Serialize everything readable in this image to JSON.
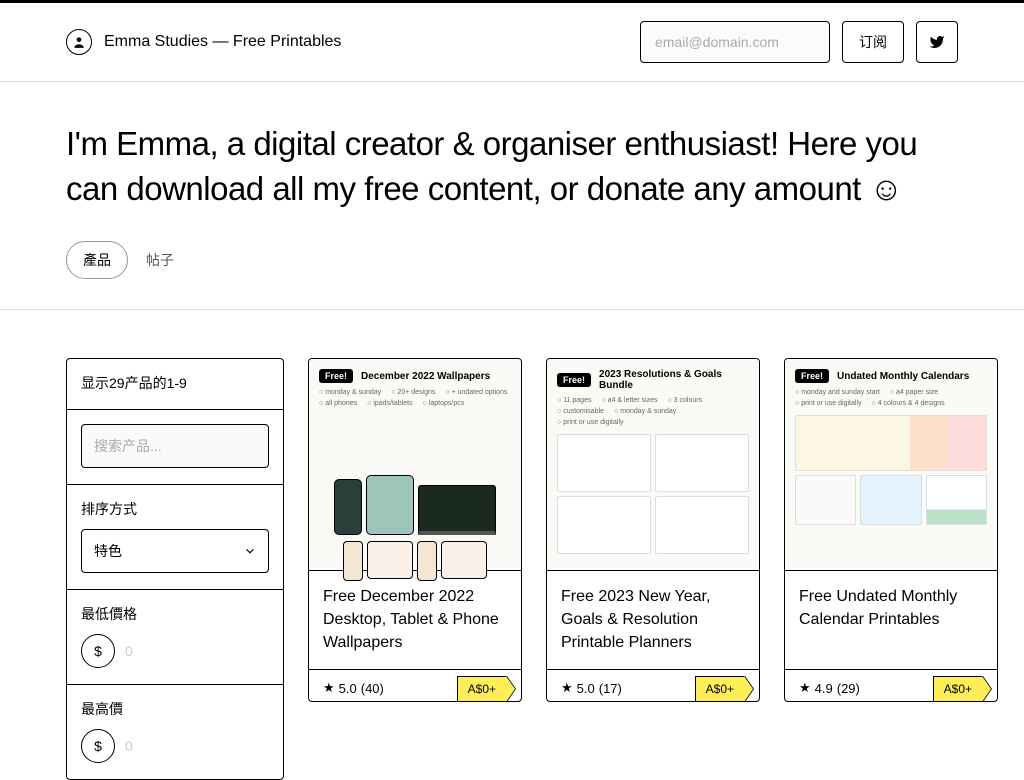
{
  "header": {
    "title": "Emma Studies — Free Printables",
    "email_placeholder": "email@domain.com",
    "subscribe_label": "订阅"
  },
  "hero": {
    "text": "I'm Emma, a digital creator & organiser enthusiast! Here you can download all my free content, or donate any amount ☺"
  },
  "tabs": {
    "products": "產品",
    "posts": "帖子"
  },
  "sidebar": {
    "results_count": "显示29产品的1-9",
    "search_placeholder": "搜索产品...",
    "sort_label": "排序方式",
    "sort_value": "特色",
    "min_price_label": "最低價格",
    "max_price_label": "最高價",
    "currency": "$",
    "price_placeholder": "0"
  },
  "thumbs": [
    {
      "free": "Free!",
      "title": "December 2022 Wallpapers",
      "meta": [
        "monday & sunday",
        "20+ designs",
        "+ undated options",
        "all phones",
        "ipads/tablets",
        "laptops/pcs"
      ]
    },
    {
      "free": "Free!",
      "title": "2023 Resolutions & Goals Bundle",
      "meta": [
        "11 pages",
        "a4 & letter sizes",
        "3 colours",
        "customisable",
        "monday & sunday",
        "print or use digitally"
      ]
    },
    {
      "free": "Free!",
      "title": "Undated Monthly Calendars",
      "meta": [
        "monday and sunday start",
        "a4 paper size",
        "print or use digitally",
        "4 colours & 4 designs"
      ]
    }
  ],
  "products": [
    {
      "title": "Free December 2022 Desktop, Tablet & Phone Wallpapers",
      "rating": "5.0",
      "count": "(40)",
      "price": "A$0+"
    },
    {
      "title": "Free 2023 New Year, Goals & Resolution Printable Planners",
      "rating": "5.0",
      "count": "(17)",
      "price": "A$0+"
    },
    {
      "title": "Free Undated Monthly Calendar Printables",
      "rating": "4.9",
      "count": "(29)",
      "price": "A$0+"
    }
  ]
}
